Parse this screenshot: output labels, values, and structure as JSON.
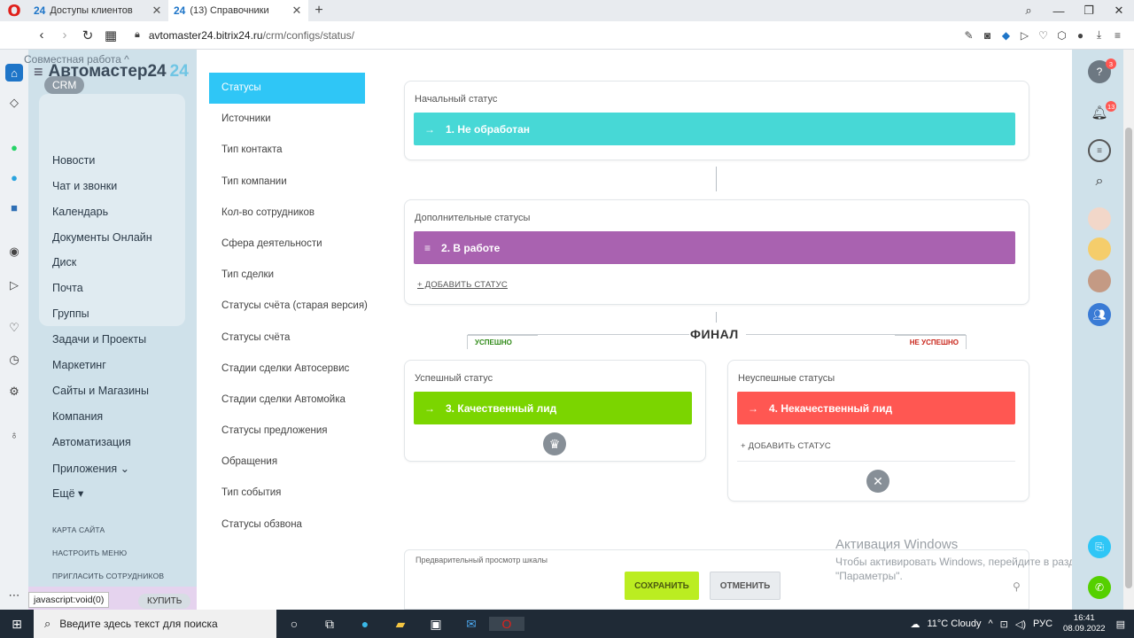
{
  "browser": {
    "tabs": [
      {
        "favicon": "24",
        "title": "Доступы клиентов",
        "active": false
      },
      {
        "favicon": "24",
        "title": "(13) Справочники",
        "active": true
      }
    ],
    "url_host": "avtomaster24.bitrix24.ru",
    "url_path": "/crm/configs/status/",
    "status_text": "javascript:void(0)"
  },
  "logo": {
    "name": "Автомастер24",
    "suffix": "24"
  },
  "left_menu": {
    "group_label": "Совместная работа ^",
    "active_pill": "CRM",
    "items": [
      "Новости",
      "Чат и звонки",
      "Календарь",
      "Документы Онлайн",
      "Диск",
      "Почта",
      "Группы",
      "Задачи и Проекты",
      "Маркетинг",
      "Сайты и Магазины",
      "Компания",
      "Автоматизация",
      "Приложения ⌄",
      "Ещё ▾"
    ],
    "small_links": [
      "КАРТА САЙТА",
      "НАСТРОИТЬ МЕНЮ",
      "ПРИГЛАСИТЬ СОТРУДНИКОВ"
    ],
    "buy_label": "КУПИТЬ"
  },
  "subnav": {
    "items": [
      "Статусы",
      "Источники",
      "Тип контакта",
      "Тип компании",
      "Кол-во сотрудников",
      "Сфера деятельности",
      "Тип сделки",
      "Статусы счёта (старая версия)",
      "Статусы счёта",
      "Стадии сделки Автосервис",
      "Стадии сделки Автомойка",
      "Статусы предложения",
      "Обращения",
      "Тип события",
      "Статусы обзвона"
    ]
  },
  "initial": {
    "title": "Начальный статус",
    "status": "1. Не обработан",
    "glyph": "→"
  },
  "additional": {
    "title": "Дополнительные статусы",
    "status": "2. В работе",
    "glyph": "≡",
    "add_label": "+ ДОБАВИТЬ СТАТУС"
  },
  "final": {
    "label": "ФИНАЛ",
    "success_tag": "УСПЕШНО",
    "fail_tag": "НЕ УСПЕШНО"
  },
  "success": {
    "title": "Успешный статус",
    "status": "3. Качественный лид",
    "glyph": "→"
  },
  "failure": {
    "title": "Неуспешные статусы",
    "status": "4. Некачественный лид",
    "glyph": "→",
    "add_label": "+ ДОБАВИТЬ СТАТУС"
  },
  "footer": {
    "preview_label": "Предварительный просмотр шкалы",
    "save": "СОХРАНИТЬ",
    "cancel": "ОТМЕНИТЬ"
  },
  "watermark": {
    "title": "Активация Windows",
    "subtitle": "Чтобы активировать Windows, перейдите в раздел \"Параметры\"."
  },
  "right_panel": {
    "help_badge": "3",
    "notif_badge": "13"
  },
  "taskbar": {
    "search_placeholder": "Введите здесь текст для поиска",
    "weather": "11°C  Cloudy",
    "lang": "РУС",
    "time": "16:41",
    "date": "08.09.2022"
  },
  "colors": {
    "initial": "#47d8d6",
    "additional": "#a962b0",
    "success": "#7bd500",
    "failure": "#ff5752",
    "accent": "#2fc6f6"
  }
}
